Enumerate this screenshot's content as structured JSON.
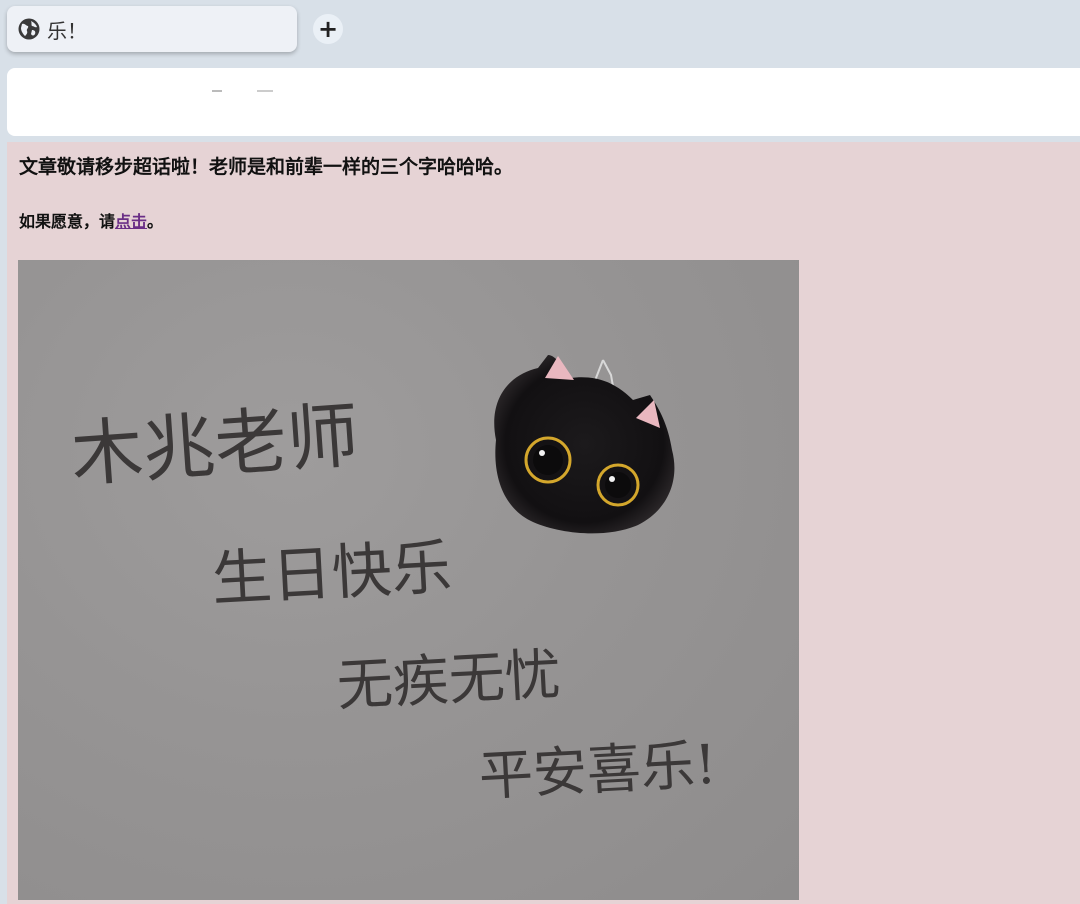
{
  "tab": {
    "title": "乐！",
    "icon": "globe-icon"
  },
  "new_tab": {
    "label": "+",
    "icon": "plus-icon"
  },
  "post": {
    "line1": "文章敬请移步超话啦！老师是和前辈一样的三个字哈哈哈。",
    "line2_before": "如果愿意，请",
    "line2_link": "点击",
    "line2_after": "。"
  },
  "photo": {
    "handwriting": [
      "木兆老师",
      "生日快乐",
      "无疾无忧",
      "平安喜乐!"
    ],
    "subject": "black cat plush keychain"
  },
  "colors": {
    "tab_bar_bg": "#d8e0e8",
    "content_bg": "#e6d3d5",
    "link": "#6a2e86",
    "photo_bg": "#969494"
  }
}
